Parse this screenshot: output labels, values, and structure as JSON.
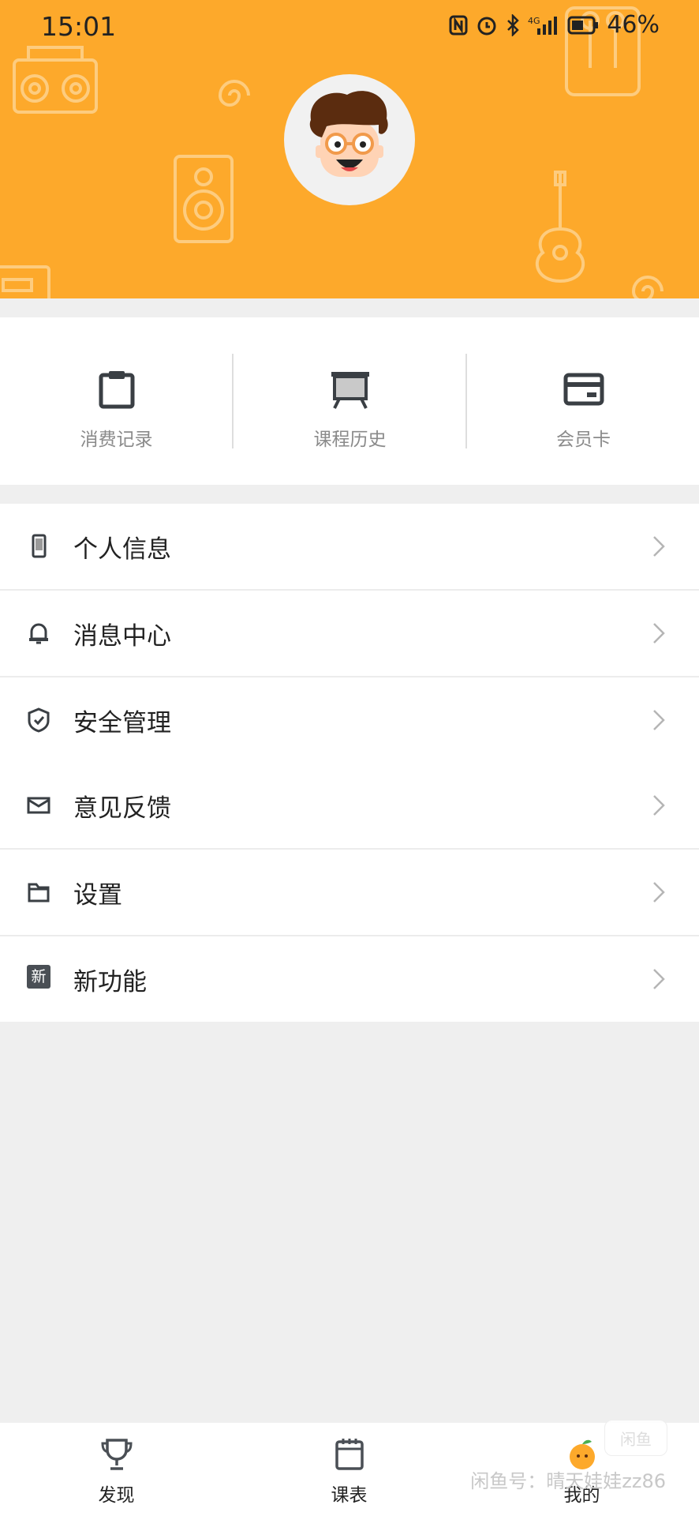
{
  "status_bar": {
    "time": "15:01",
    "battery": "46%"
  },
  "profile": {
    "avatar_icon": "cartoon-avatar-icon"
  },
  "quick_actions": [
    {
      "label": "消费记录",
      "icon": "clipboard-icon"
    },
    {
      "label": "课程历史",
      "icon": "presentation-board-icon"
    },
    {
      "label": "会员卡",
      "icon": "card-icon"
    }
  ],
  "menu_group_1": [
    {
      "label": "个人信息",
      "icon": "phone-icon"
    },
    {
      "label": "消息中心",
      "icon": "bell-icon"
    },
    {
      "label": "安全管理",
      "icon": "shield-icon"
    }
  ],
  "menu_group_2": [
    {
      "label": "意见反馈",
      "icon": "envelope-icon"
    },
    {
      "label": "设置",
      "icon": "folder-icon"
    },
    {
      "label": "新功能",
      "icon": "new-badge-icon",
      "icon_text": "新"
    }
  ],
  "tab_bar": [
    {
      "label": "发现",
      "icon": "trophy-icon"
    },
    {
      "label": "课表",
      "icon": "calendar-icon"
    },
    {
      "label": "我的",
      "icon": "orange-icon",
      "active": true
    }
  ],
  "watermark": {
    "text": "闲鱼号：晴天娃娃zz86",
    "badge": "闲鱼"
  },
  "colors": {
    "header_bg": "#fda92b",
    "background": "#efefef",
    "icon_dark": "#3a3f44",
    "chevron": "#b5b5b5"
  }
}
